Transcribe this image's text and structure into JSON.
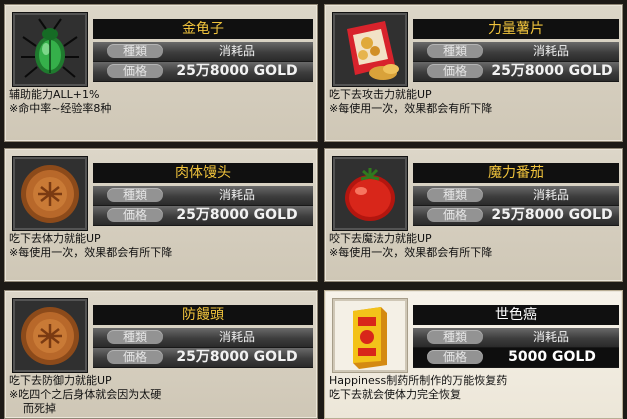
{
  "labels": {
    "type": "種類",
    "price": "価格"
  },
  "items": [
    {
      "name": "金龟子",
      "type": "消耗品",
      "price": "25万8000 GOLD",
      "desc_line1": "辅助能力ALL+1%",
      "desc_line2": "※命中率~经验率8种",
      "desc_line3": "",
      "icon": "beetle-icon"
    },
    {
      "name": "力量薯片",
      "type": "消耗品",
      "price": "25万8000 GOLD",
      "desc_line1": "吃下去攻击力就能UP",
      "desc_line2": "※每使用一次，效果都会有所下降",
      "desc_line3": "",
      "icon": "chips-bag-icon"
    },
    {
      "name": "肉体馒头",
      "type": "消耗品",
      "price": "25万8000 GOLD",
      "desc_line1": "吃下去体力就能UP",
      "desc_line2": "※每使用一次，效果都会有所下降",
      "desc_line3": "",
      "icon": "mooncake-icon"
    },
    {
      "name": "魔力番茄",
      "type": "消耗品",
      "price": "25万8000 GOLD",
      "desc_line1": "咬下去魔法力就能UP",
      "desc_line2": "※每使用一次，效果都会有所下降",
      "desc_line3": "",
      "icon": "tomato-icon"
    },
    {
      "name": "防饅頭",
      "type": "消耗品",
      "price": "25万8000 GOLD",
      "desc_line1": "吃下去防御力就能UP",
      "desc_line2": "※吃四个之后身体就会因为太硬",
      "desc_line3": "而死掉",
      "icon": "mooncake-icon"
    },
    {
      "name": "世色癌",
      "type": "消耗品",
      "price": "5000 GOLD",
      "desc_line1": "Happiness制药所制作的万能恢复药",
      "desc_line2": "吃下去就会使体力完全恢复",
      "desc_line3": "",
      "icon": "medicine-box-icon"
    }
  ]
}
